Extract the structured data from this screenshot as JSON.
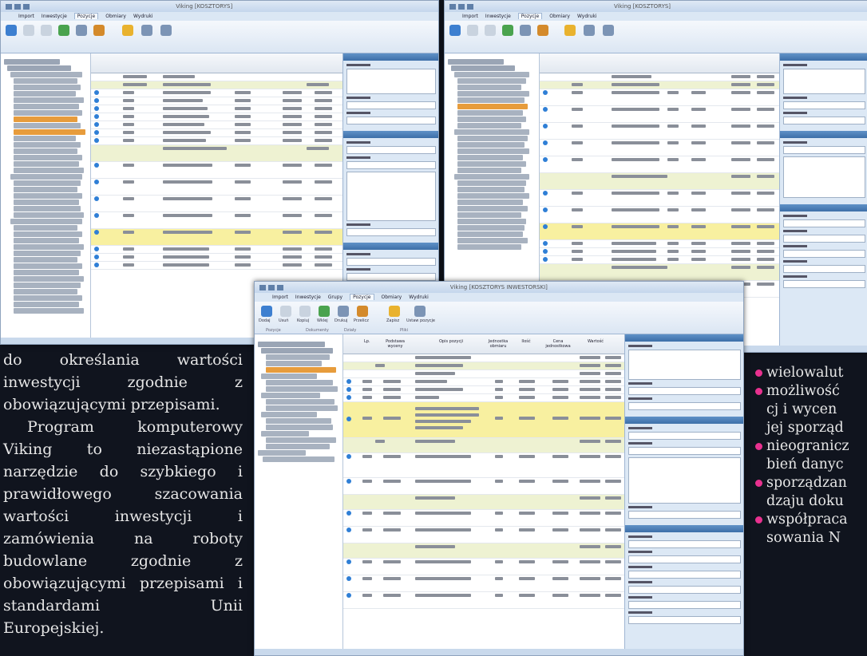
{
  "colors": {
    "background": "#10141e",
    "text": "#e6e6e6",
    "bullet": "#e8318f",
    "highlight_row": "#f8f0a0"
  },
  "screens": [
    {
      "menu": [
        "Import",
        "Inwestycje",
        "Pozycje",
        "Obmiary",
        "Wydruki"
      ],
      "title": "Viking [KOSZTORYS]"
    },
    {
      "menu": [
        "Import",
        "Inwestycje",
        "Pozycje",
        "Obmiary",
        "Wydruki"
      ],
      "title": "Viking [KOSZTORYS]"
    },
    {
      "menu": [
        "Import",
        "Inwestycje",
        "Grupy",
        "Pozycje",
        "Obmiary",
        "Wydruki"
      ],
      "title": "Viking [KOSZTORYS INWESTORSKI]",
      "ribbon_buttons": [
        "Dodaj",
        "Usuń",
        "Kopiuj",
        "Wklej",
        "Drukuj",
        "Przelicz",
        "Zapisz",
        "Ustaw pozycje"
      ],
      "ribbon_groups": [
        "Pozycje",
        "Dokumenty",
        "Działy",
        "Pliki"
      ],
      "grid_headers": [
        "Lp.",
        "Podstawa wyceny",
        "Opis pozycji",
        "Jednostka obmiaru",
        "Ilość",
        "Cena jednostkowa",
        "Wartość"
      ]
    }
  ],
  "left_column": {
    "para1": "do określania wartości inwestycji zgodnie z obowiązującymi przepisami.",
    "para2": "Program komputerowy Viking to niezastąpione narzędzie do szybkiego i prawidłowego szacowania wartości inwestycji i zamówienia na roboty budowlane zgodnie z obowiązującymi przepisami i standardami Unii Europejskiej."
  },
  "right_bullets": [
    {
      "first": "wielowalut",
      "rest": []
    },
    {
      "first": "możliwość",
      "rest": [
        "cj i wycen",
        "jej sporząd"
      ]
    },
    {
      "first": "nieogranicz",
      "rest": [
        "bień danyc"
      ]
    },
    {
      "first": "sporządzan",
      "rest": [
        "dzaju doku"
      ]
    },
    {
      "first": "współpraca",
      "rest": [
        "sowania N"
      ]
    }
  ]
}
